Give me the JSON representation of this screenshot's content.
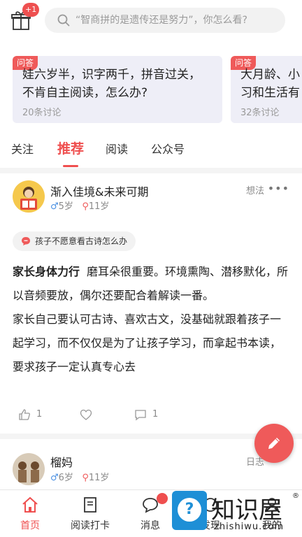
{
  "header": {
    "gift_badge": "+1",
    "search_placeholder": "“智商拼的是遗传还是努力”，你怎么看?"
  },
  "qa_cards": [
    {
      "tag": "问答",
      "title": "娃六岁半，识字两千，拼音过关，\n不肯自主阅读，怎么办?",
      "count": "20条讨论"
    },
    {
      "tag": "问答",
      "title": "大月龄、小\n习和生活有",
      "count": "32条讨论"
    }
  ],
  "tabs": [
    {
      "label": "关注",
      "active": false
    },
    {
      "label": "推荐",
      "active": true
    },
    {
      "label": "阅读",
      "active": false
    },
    {
      "label": "公众号",
      "active": false
    }
  ],
  "posts": [
    {
      "username": "渐入佳境&未来可期",
      "child_gender_icon": "male-icon",
      "child_age": "5岁",
      "child2_icon": "female-icon",
      "child2_age": "11岁",
      "type": "想法",
      "more": "•••",
      "topic": "孩子不愿意看古诗怎么办",
      "lead": "家长身体力行",
      "body": "磨耳朵很重要。环境熏陶、潜移默化，所以音频要放，偶尔还要配合着解读一番。\n家长自己要认可古诗、喜欢古文，没基础就跟着孩子一起学习，而不仅仅是为了让孩子学习，而拿起书本读，要求孩子一定认真专心去",
      "likes": "1",
      "favorites": "",
      "comments": "1"
    },
    {
      "username": "榴妈",
      "child_age": "6岁",
      "child2_age": "11岁",
      "type": "日志"
    }
  ],
  "bottom_nav": [
    {
      "label": "首页",
      "icon": "home-icon",
      "active": true
    },
    {
      "label": "阅读打卡",
      "icon": "book-icon",
      "active": false
    },
    {
      "label": "消息",
      "icon": "message-icon",
      "active": false
    },
    {
      "label": "发现",
      "icon": "discover-icon",
      "active": false
    },
    {
      "label": "我的",
      "icon": "profile-icon",
      "active": false
    }
  ],
  "watermark": {
    "cn": "知识屋",
    "en": "zhishiwu.com",
    "reg": "®",
    "mark": "?"
  },
  "colors": {
    "accent": "#ef4f4f",
    "card_bg": "#eeeef7",
    "male": "#4a90e2",
    "watermark_blue": "#1e8fd6"
  }
}
